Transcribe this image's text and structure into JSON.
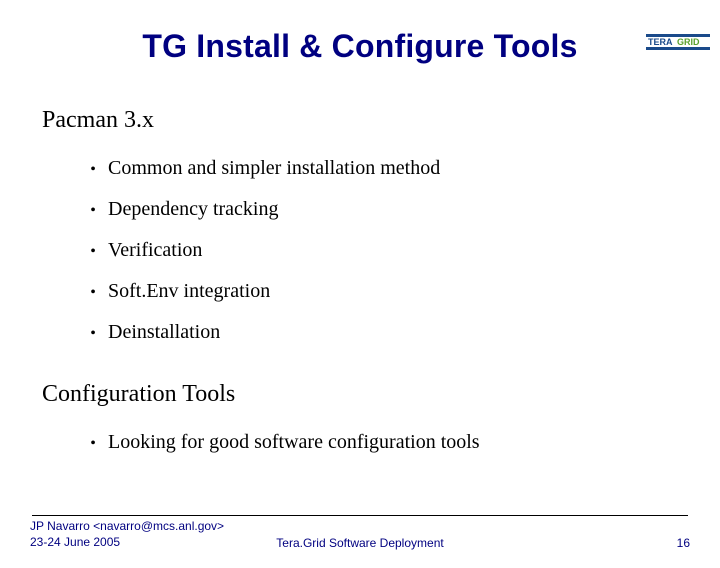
{
  "title": "TG Install & Configure Tools",
  "logo": {
    "name": "teragrid-logo"
  },
  "sections": [
    {
      "heading": "Pacman 3.x",
      "items": [
        "Common and simpler installation method",
        "Dependency tracking",
        "Verification",
        "Soft.Env integration",
        "Deinstallation"
      ]
    },
    {
      "heading": "Configuration Tools",
      "items": [
        "Looking for good software configuration tools"
      ]
    }
  ],
  "footer": {
    "author": "JP Navarro <navarro@mcs.anl.gov>",
    "date": "23-24 June 2005",
    "center": "Tera.Grid Software Deployment",
    "page": "16"
  }
}
